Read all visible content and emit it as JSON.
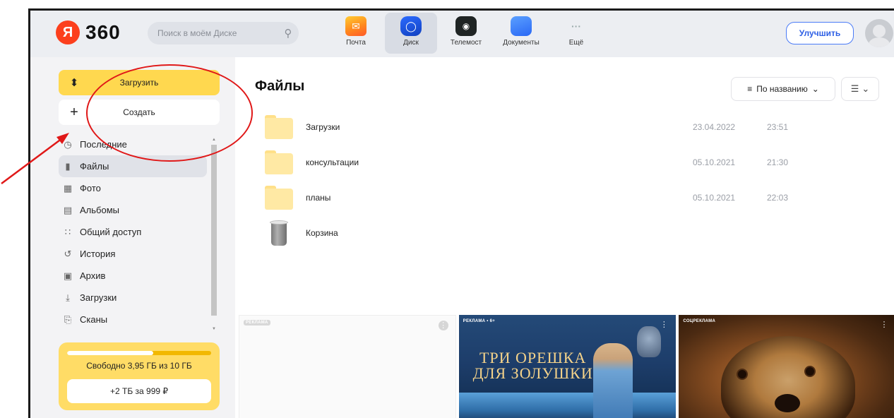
{
  "header": {
    "logo_badge": "Я",
    "logo_text": "360",
    "search_placeholder": "Поиск в моём Диске",
    "apps": [
      {
        "label": "Почта",
        "icon": "mail-icon"
      },
      {
        "label": "Диск",
        "icon": "disk-icon"
      },
      {
        "label": "Телемост",
        "icon": "telemost-icon"
      },
      {
        "label": "Документы",
        "icon": "documents-icon"
      },
      {
        "label": "Ещё",
        "icon": "more-icon"
      }
    ],
    "upgrade_label": "Улучшить"
  },
  "sidebar": {
    "upload_label": "Загрузить",
    "create_label": "Создать",
    "items": [
      {
        "label": "Последние",
        "icon": "clock-icon"
      },
      {
        "label": "Файлы",
        "icon": "file-icon"
      },
      {
        "label": "Фото",
        "icon": "photo-icon"
      },
      {
        "label": "Альбомы",
        "icon": "albums-icon"
      },
      {
        "label": "Общий доступ",
        "icon": "shared-icon"
      },
      {
        "label": "История",
        "icon": "history-icon"
      },
      {
        "label": "Архив",
        "icon": "archive-icon"
      },
      {
        "label": "Загрузки",
        "icon": "download-icon"
      },
      {
        "label": "Сканы",
        "icon": "scan-icon"
      }
    ],
    "storage_text": "Свободно 3,95 ГБ из 10 ГБ",
    "storage_used_fraction": 0.6,
    "storage_offer": "+2 ТБ за 999 ₽"
  },
  "main": {
    "title": "Файлы",
    "sort_label": "По названию",
    "files": [
      {
        "name": "Загрузки",
        "date": "23.04.2022",
        "time": "23:51",
        "type": "folder"
      },
      {
        "name": "консультации",
        "date": "05.10.2021",
        "time": "21:30",
        "type": "folder"
      },
      {
        "name": "планы",
        "date": "05.10.2021",
        "time": "22:03",
        "type": "folder"
      },
      {
        "name": "Корзина",
        "date": "",
        "time": "",
        "type": "trash"
      }
    ],
    "ads": [
      {
        "label": "РЕКЛАМА"
      },
      {
        "label": "РЕКЛАМА • 6+",
        "title_line1": "ТРИ ОРЕШКА",
        "title_line2": "ДЛЯ ЗОЛУШКИ"
      },
      {
        "label": "СОЦРЕКЛАМА"
      }
    ]
  },
  "colors": {
    "accent_yellow": "#ffd84f",
    "brand_red": "#fc3f1d",
    "link_blue": "#2d5fe5",
    "annotation_red": "#e01818"
  }
}
